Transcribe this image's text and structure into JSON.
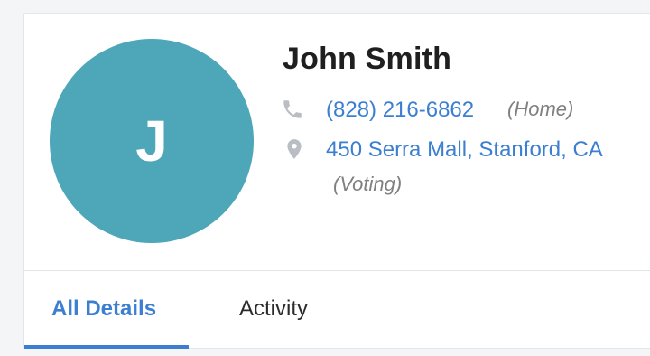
{
  "contact": {
    "initial": "J",
    "name": "John Smith",
    "phone": "(828) 216-6862",
    "phone_type": "(Home)",
    "address": "450 Serra Mall, Stanford, CA",
    "address_type": "(Voting)",
    "avatar_color": "#4da7b9"
  },
  "icons": {
    "phone": "phone-icon",
    "location": "location-pin-icon"
  },
  "tabs": [
    {
      "label": "All Details",
      "active": true
    },
    {
      "label": "Activity",
      "active": false
    }
  ],
  "colors": {
    "link": "#3c7fd1",
    "muted": "#808080",
    "accent": "#3c7fd1"
  }
}
